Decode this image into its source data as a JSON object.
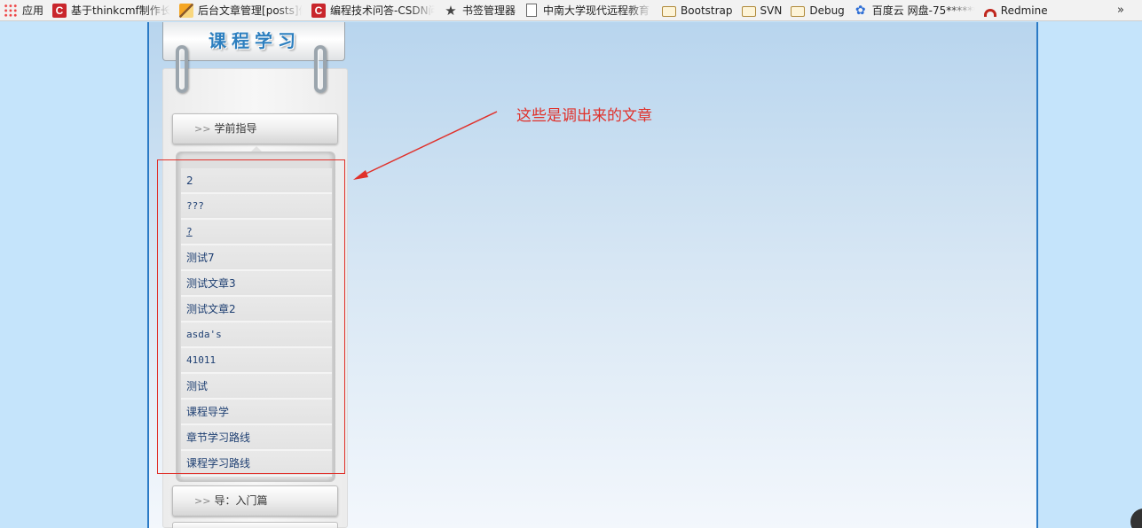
{
  "bookmarks": {
    "items": [
      {
        "label": "应用",
        "icon": "apps-grid-icon"
      },
      {
        "label": "基于thinkcmf制作长沙",
        "icon": "csdn-icon"
      },
      {
        "label": "后台文章管理[posts]修",
        "icon": "image-icon"
      },
      {
        "label": "编程技术问答-CSDN问",
        "icon": "csdn-icon"
      },
      {
        "label": "书签管理器",
        "icon": "star-icon"
      },
      {
        "label": "中南大学现代远程教育",
        "icon": "page-icon"
      },
      {
        "label": "Bootstrap",
        "icon": "folder-icon"
      },
      {
        "label": "SVN",
        "icon": "folder-icon"
      },
      {
        "label": "Debug",
        "icon": "folder-icon"
      },
      {
        "label": "百度云 网盘-75******",
        "icon": "baidu-icon"
      },
      {
        "label": "Redmine",
        "icon": "redmine-icon"
      }
    ],
    "more": "»"
  },
  "sidebar": {
    "title": "课程学习",
    "menus": [
      {
        "arrow": ">>",
        "label": "学前指导"
      },
      {
        "arrow": ">>",
        "label": "导：入门篇"
      }
    ],
    "articles": [
      "2",
      "???",
      "?",
      "测试7",
      "测试文章3",
      "测试文章2",
      "asda's",
      "41011",
      "测试",
      "课程导学",
      "章节学习路线",
      "课程学习路线"
    ]
  },
  "annotation": {
    "text": "这些是调出来的文章",
    "color": "#e0302a"
  },
  "colors": {
    "page_background": "#c5e4fb",
    "frame_border": "#2b7ac5",
    "link": "#1e3f72"
  }
}
